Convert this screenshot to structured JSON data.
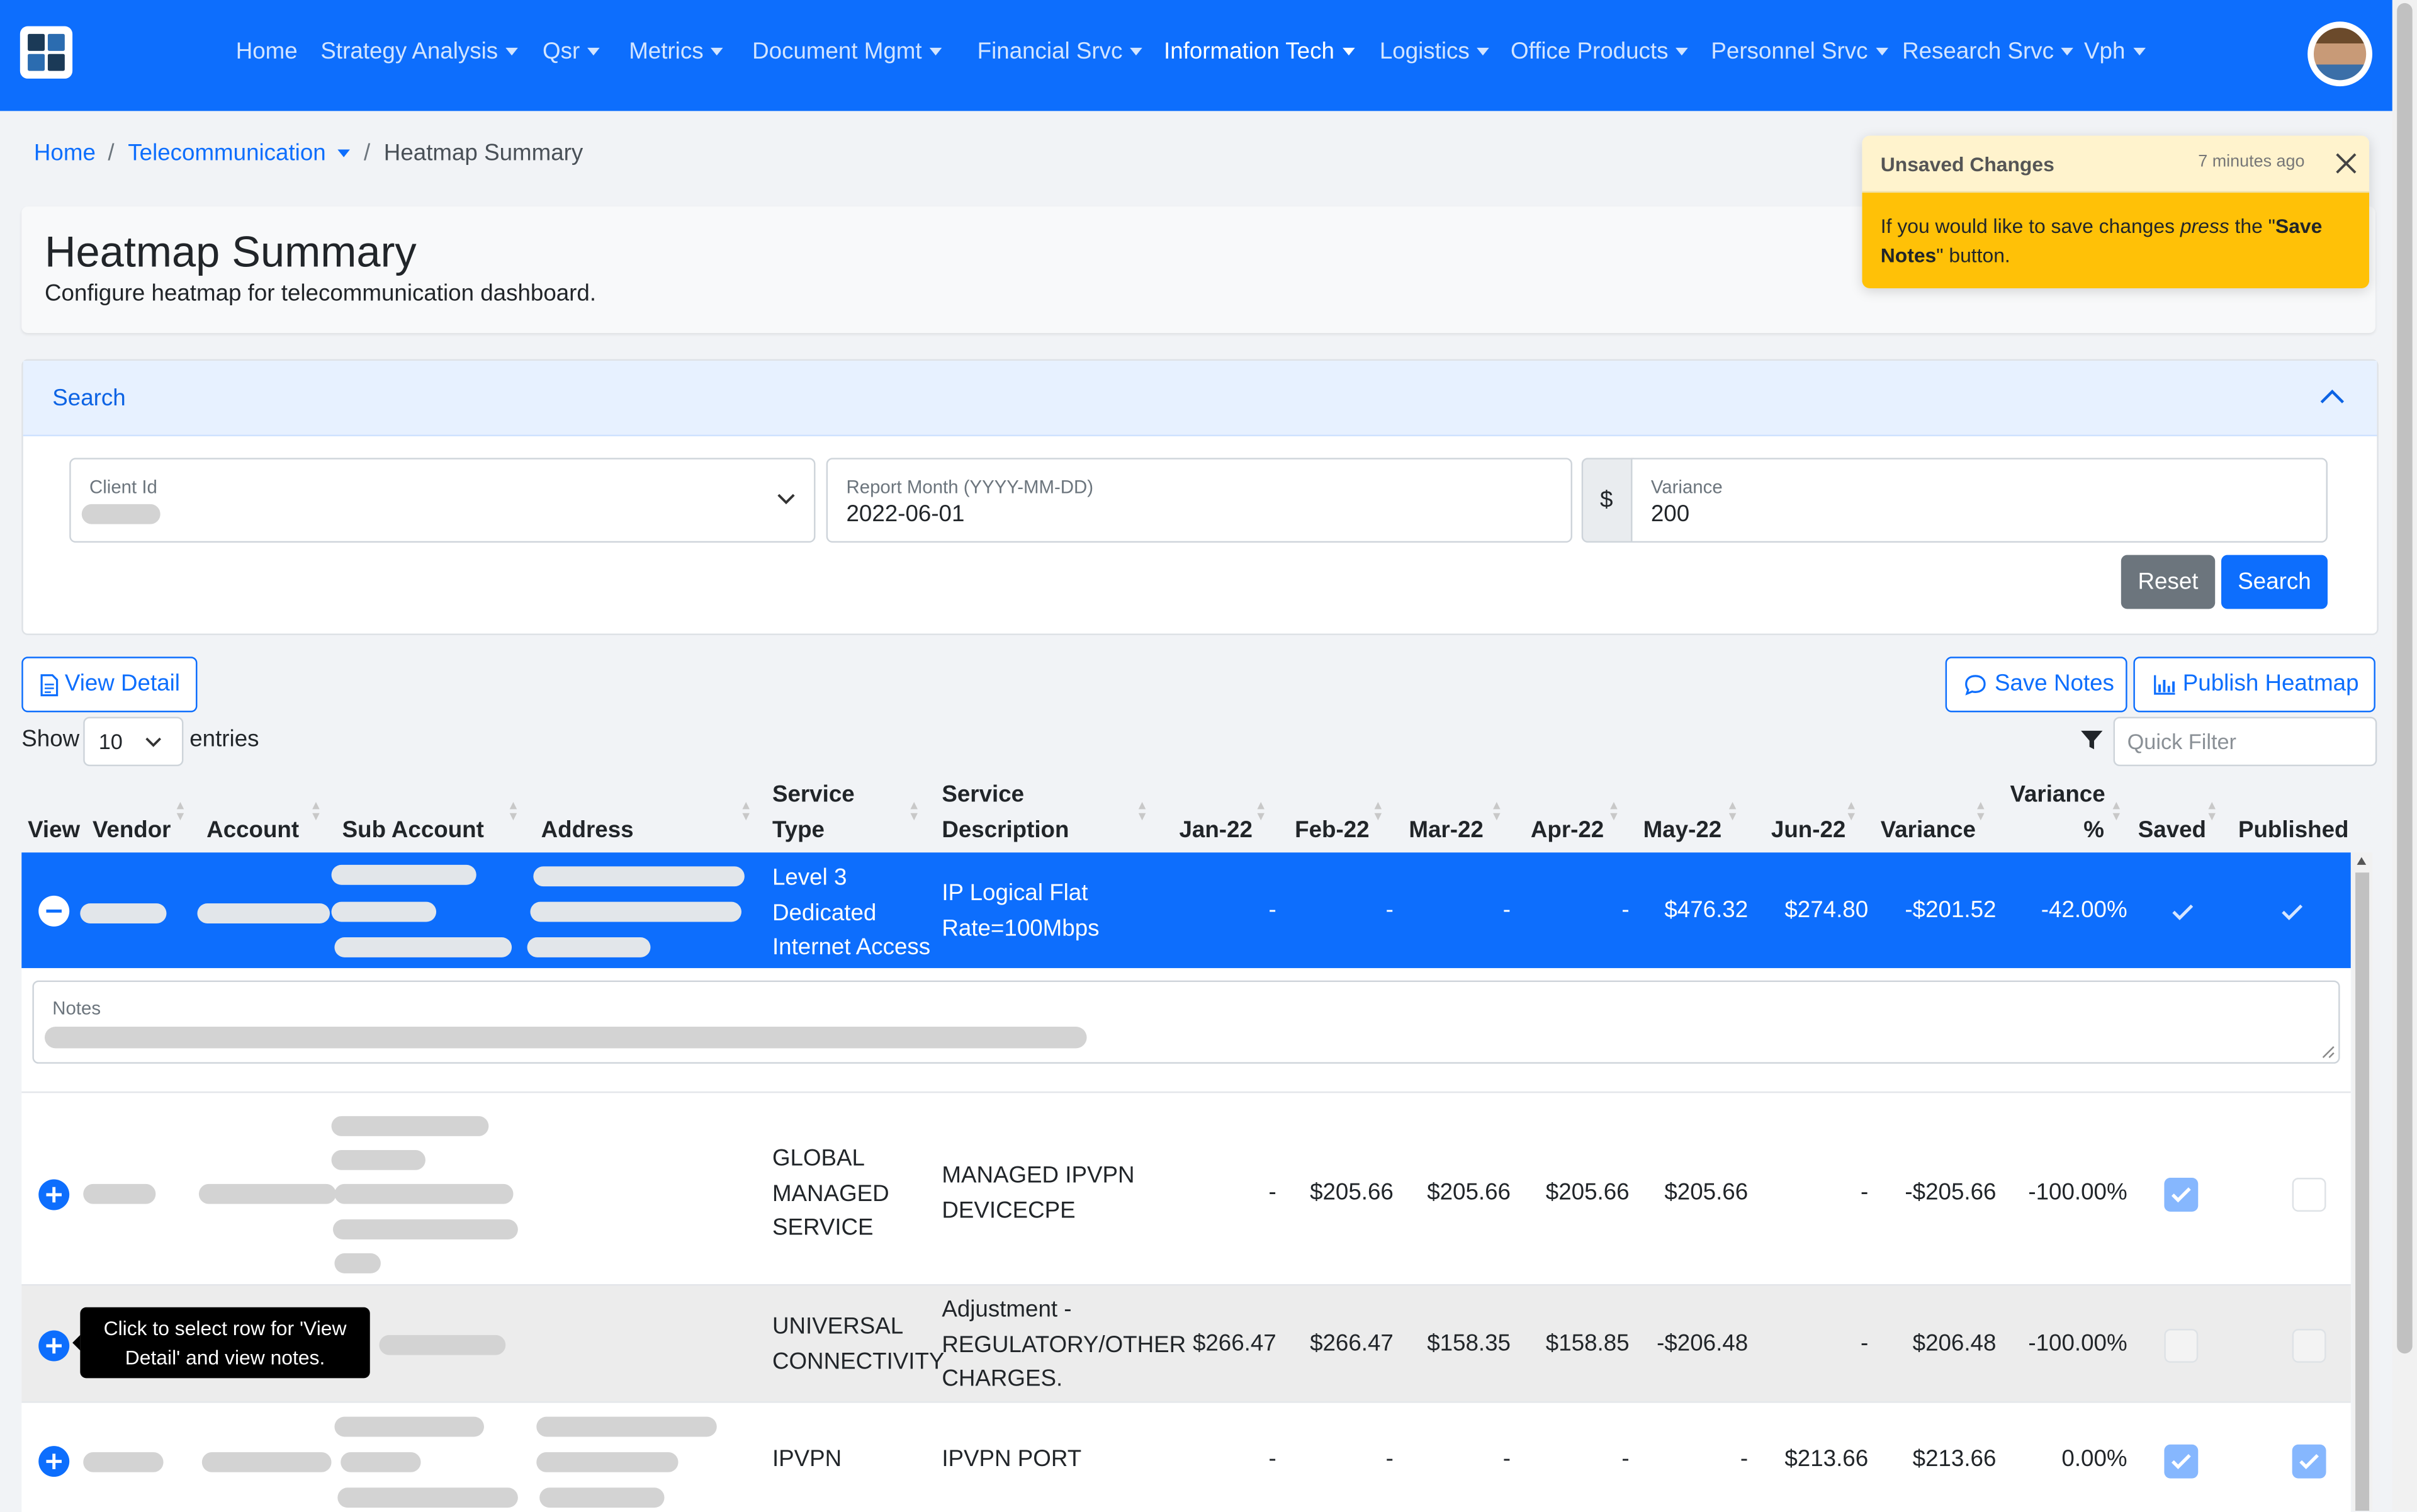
{
  "nav": {
    "items": [
      "Home",
      "Strategy Analysis",
      "Qsr",
      "Metrics",
      "Document Mgmt",
      "Financial Srvc",
      "Information Tech",
      "Logistics",
      "Office Products",
      "Personnel Srvc",
      "Research Srvc",
      "Vph"
    ],
    "active": "Information Tech",
    "colors": {
      "bar": "#0d6efd"
    }
  },
  "breadcrumb": {
    "home": "Home",
    "section": "Telecommunication",
    "current": "Heatmap Summary",
    "separator": "/"
  },
  "page": {
    "title": "Heatmap Summary",
    "subtitle": "Configure heatmap for telecommunication dashboard."
  },
  "toast": {
    "title": "Unsaved Changes",
    "time": "7 minutes ago",
    "body_1": "If you would like to save changes ",
    "body_em": "press",
    "body_2": " the \"",
    "body_strong": "Save Notes",
    "body_3": "\" button."
  },
  "search": {
    "header": "Search",
    "client_label": "Client Id",
    "month_label": "Report Month (YYYY-MM-DD)",
    "month_value": "2022-06-01",
    "variance_prefix": "$",
    "variance_label": "Variance",
    "variance_value": "200",
    "reset": "Reset",
    "submit": "Search"
  },
  "toolbar": {
    "view_detail": "View Detail",
    "save_notes": "Save Notes",
    "publish": "Publish Heatmap",
    "show": "Show",
    "entries_value": "10",
    "entries": "entries",
    "quick_filter_placeholder": "Quick Filter"
  },
  "table": {
    "headers": {
      "view": "View",
      "vendor": "Vendor",
      "account": "Account",
      "sub_account": "Sub Account",
      "address": "Address",
      "service_type_1": "Service",
      "service_type_2": "Type",
      "service_desc_1": "Service",
      "service_desc_2": "Description",
      "jan": "Jan-22",
      "feb": "Feb-22",
      "mar": "Mar-22",
      "apr": "Apr-22",
      "may": "May-22",
      "jun": "Jun-22",
      "variance": "Variance",
      "variance_pct_1": "Variance",
      "variance_pct_2": "%",
      "saved": "Saved",
      "published": "Published"
    },
    "rows": [
      {
        "service_type": [
          "Level 3",
          "Dedicated",
          "Internet Access"
        ],
        "service_desc": [
          "IP Logical Flat",
          "Rate=100Mbps"
        ],
        "jan": "-",
        "feb": "-",
        "mar": "-",
        "apr": "-",
        "may": "$476.32",
        "jun": "$274.80",
        "variance": "-$201.52",
        "variance_pct": "-42.00%",
        "saved": true,
        "published": true,
        "expanded": true
      },
      {
        "service_type": [
          "GLOBAL",
          "MANAGED",
          "SERVICE"
        ],
        "service_desc": [
          "MANAGED IPVPN",
          "DEVICECPE"
        ],
        "jan": "-",
        "feb": "$205.66",
        "mar": "$205.66",
        "apr": "$205.66",
        "may": "$205.66",
        "jun": "-",
        "variance": "-$205.66",
        "variance_pct": "-100.00%",
        "saved": true,
        "published": false
      },
      {
        "service_type": [
          "UNIVERSAL",
          "CONNECTIVITY"
        ],
        "service_desc": [
          "Adjustment -",
          "REGULATORY/OTHER",
          "CHARGES."
        ],
        "jan": "$266.47",
        "feb": "$266.47",
        "mar": "$158.35",
        "apr": "$158.85",
        "may": "-$206.48",
        "jun": "-",
        "variance": "$206.48",
        "variance_pct": "-100.00%",
        "saved": false,
        "published": false
      },
      {
        "service_type": [
          "IPVPN"
        ],
        "service_desc": [
          "IPVPN PORT"
        ],
        "jan": "-",
        "feb": "-",
        "mar": "-",
        "apr": "-",
        "may": "-",
        "jun": "$213.66",
        "variance": "$213.66",
        "variance_pct": "0.00%",
        "saved": true,
        "published": true
      }
    ],
    "notes_label": "Notes"
  },
  "tooltip": {
    "line1": "Click to select row for 'View",
    "line2": "Detail' and view notes."
  }
}
